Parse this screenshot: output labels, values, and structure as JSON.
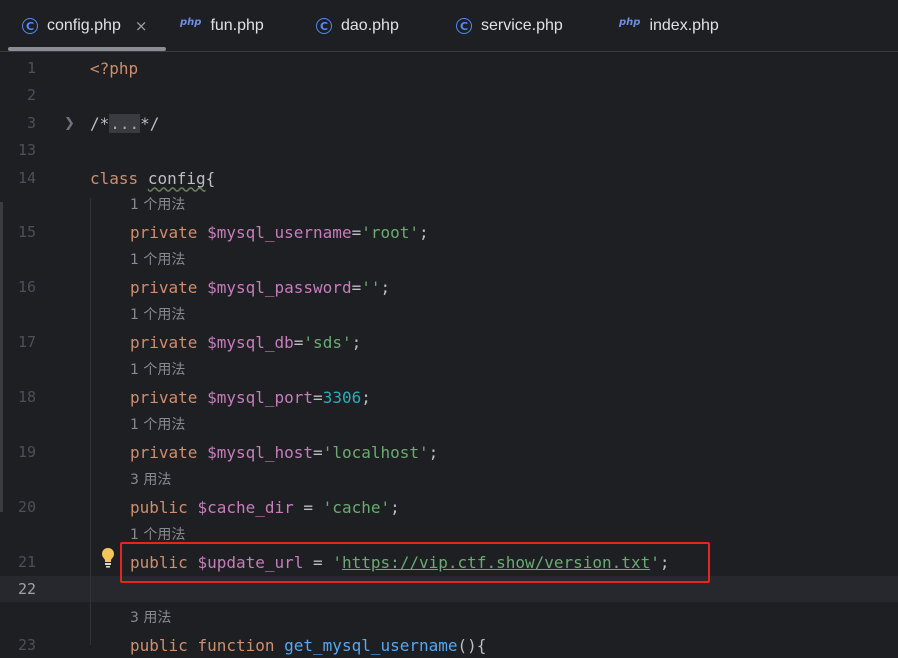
{
  "tabs": [
    {
      "label": "config.php",
      "icon": "class-c-icon",
      "active": true,
      "close": "×"
    },
    {
      "label": "fun.php",
      "icon": "php-file-icon",
      "icon_text": "php"
    },
    {
      "label": "dao.php",
      "icon": "class-c-icon"
    },
    {
      "label": "service.php",
      "icon": "class-c-icon"
    },
    {
      "label": "index.php",
      "icon": "php-file-icon",
      "icon_text": "php"
    }
  ],
  "gutter": {
    "numbers": [
      "1",
      "2",
      "3",
      "13",
      "14",
      "15",
      "16",
      "17",
      "18",
      "19",
      "20",
      "21",
      "22",
      "23"
    ],
    "current_line": "22"
  },
  "code": {
    "l1": "<?php",
    "l3_open": "/*",
    "l3_fold": "...",
    "l3_close": "*/",
    "l14_kw": "class",
    "l14_name": "config",
    "l14_brace": "{",
    "hint_15": "1 个用法",
    "l15_kw": "private",
    "l15_var": "$mysql_username",
    "l15_eq": "=",
    "l15_val": "'root'",
    "l15_end": ";",
    "hint_16": "1 个用法",
    "l16_kw": "private",
    "l16_var": "$mysql_password",
    "l16_eq": "=",
    "l16_val": "''",
    "l16_end": ";",
    "hint_17": "1 个用法",
    "l17_kw": "private",
    "l17_var": "$mysql_db",
    "l17_eq": "=",
    "l17_val": "'sds'",
    "l17_end": ";",
    "hint_18": "1 个用法",
    "l18_kw": "private",
    "l18_var": "$mysql_port",
    "l18_eq": "=",
    "l18_val": "3306",
    "l18_end": ";",
    "hint_19": "1 个用法",
    "l19_kw": "private",
    "l19_var": "$mysql_host",
    "l19_eq": "=",
    "l19_val": "'localhost'",
    "l19_end": ";",
    "hint_20": "3 用法",
    "l20_kw": "public",
    "l20_var": "$cache_dir",
    "l20_eq": " = ",
    "l20_val": "'cache'",
    "l20_end": ";",
    "hint_21": "1 个用法",
    "l21_kw": "public",
    "l21_var": "$update_url",
    "l21_eq": " = ",
    "l21_q1": "'",
    "l21_url": "https://vip.ctf.show/version.txt",
    "l21_q2": "'",
    "l21_end": ";",
    "hint_23": "3 用法",
    "l23_kw1": "public",
    "l23_kw2": "function",
    "l23_fn": "get_mysql_username",
    "l23_rest": "(){"
  },
  "colors": {
    "highlight_box": "#e4261f",
    "bulb": "#f2c55c"
  },
  "intention_icon": "lightbulb-icon"
}
